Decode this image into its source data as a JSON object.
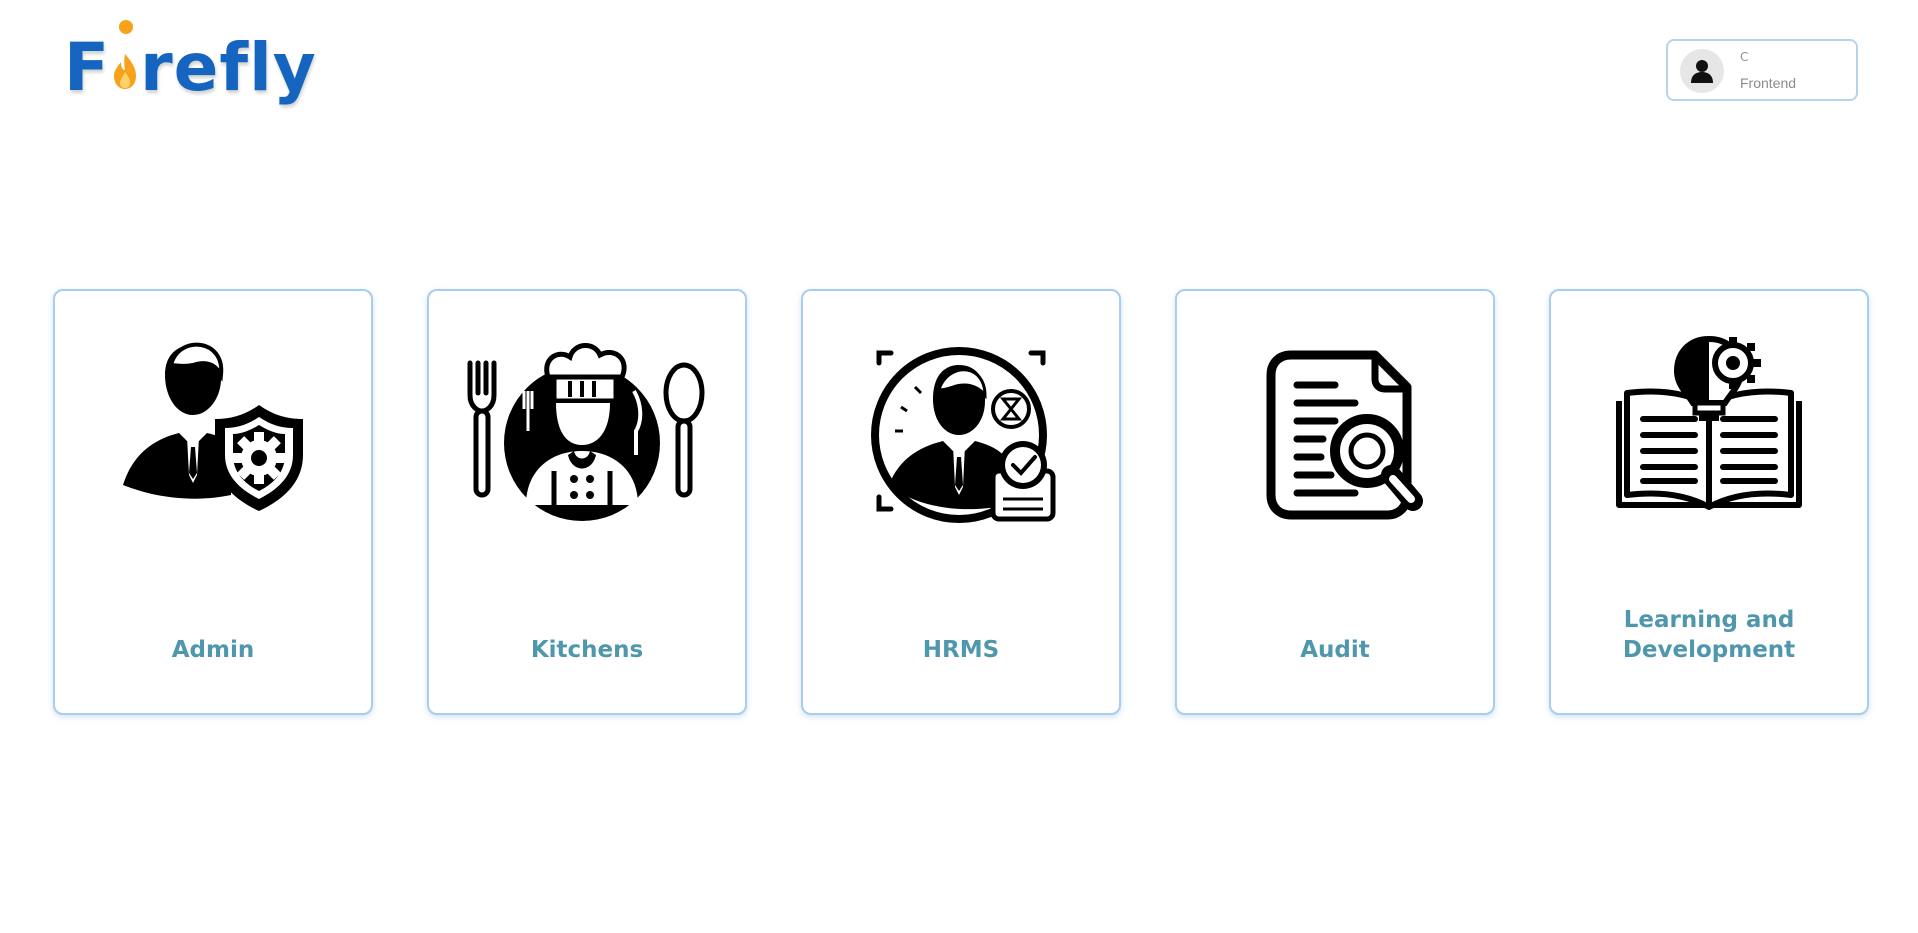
{
  "app": {
    "logo_prefix": "F",
    "logo_suffix": "refly",
    "brand_color": "#1565c0",
    "accent_color": "#f6a21a"
  },
  "user": {
    "name": "C",
    "role": "Frontend",
    "icon": "user-icon"
  },
  "modules": [
    {
      "label": "Admin",
      "icon": "admin-shield-icon"
    },
    {
      "label": "Kitchens",
      "icon": "chef-icon"
    },
    {
      "label": "HRMS",
      "icon": "hr-employee-clock-icon"
    },
    {
      "label": "Audit",
      "icon": "document-search-icon"
    },
    {
      "label": "Learning and Development",
      "icon": "book-lightbulb-icon"
    }
  ],
  "colors": {
    "card_border": "#a9cdec",
    "card_label": "#4e97ad"
  }
}
